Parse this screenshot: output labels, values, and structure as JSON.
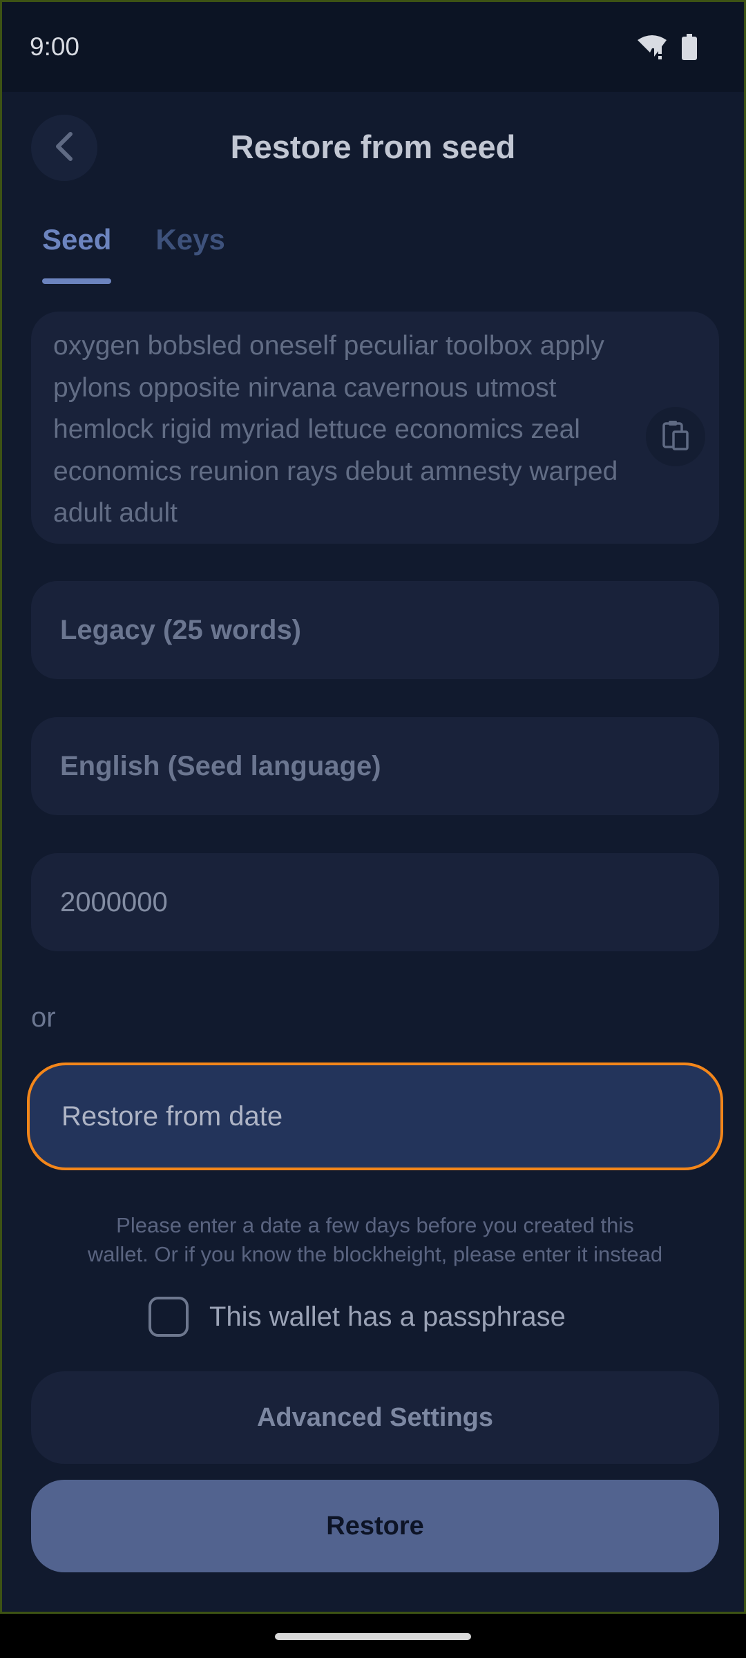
{
  "status_bar": {
    "time": "9:00",
    "icons": [
      "wifi-alert-icon",
      "battery-icon"
    ]
  },
  "header": {
    "title": "Restore from seed",
    "back_icon": "chevron-left-icon"
  },
  "tabs": [
    {
      "label": "Seed",
      "active": true
    },
    {
      "label": "Keys",
      "active": false
    }
  ],
  "seed_input": {
    "value": "oxygen bobsled oneself peculiar toolbox apply pylons opposite nirvana cavernous utmost hemlock rigid myriad lettuce economics zeal economics reunion rays debut amnesty warped adult adult",
    "paste_icon": "clipboard-paste-icon"
  },
  "seed_type": {
    "value": "Legacy (25 words)"
  },
  "seed_language": {
    "value": "English (Seed language)"
  },
  "block_height": {
    "value": "2000000"
  },
  "or_label": "or",
  "restore_date": {
    "placeholder": "Restore from date"
  },
  "hint_text": "Please enter a date a few days before you created this wallet. Or if you know the blockheight, please enter it instead",
  "passphrase": {
    "label": "This wallet has a passphrase",
    "checked": false
  },
  "advanced_settings_label": "Advanced Settings",
  "restore_label": "Restore",
  "colors": {
    "background": "#111a2e",
    "field": "#19223a",
    "accent": "#6c84bf",
    "focus_outline": "#f3861a",
    "primary_button": "#52638f"
  }
}
